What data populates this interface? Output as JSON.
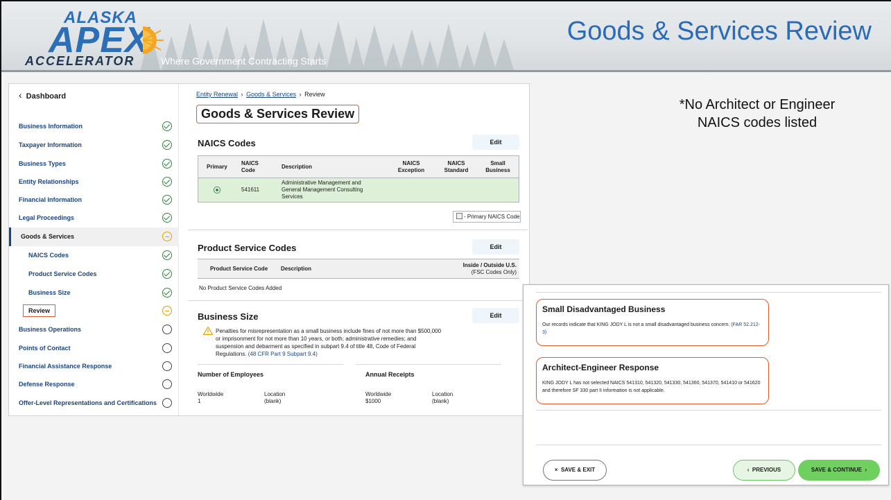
{
  "banner": {
    "logo_top": "ALASKA",
    "logo_main": "APEX",
    "logo_bottom": "ACCELERATOR",
    "tagline": "Where Government Contracting Starts",
    "slide_title": "Goods & Services Review"
  },
  "sidebar": {
    "dashboard": "Dashboard",
    "items": [
      {
        "label": "Business Information",
        "status": "complete"
      },
      {
        "label": "Taxpayer Information",
        "status": "complete"
      },
      {
        "label": "Business Types",
        "status": "complete"
      },
      {
        "label": "Entity Relationships",
        "status": "complete"
      },
      {
        "label": "Financial Information",
        "status": "complete"
      },
      {
        "label": "Legal Proceedings",
        "status": "complete"
      },
      {
        "label": "Goods & Services",
        "status": "in-progress"
      },
      {
        "label": "NAICS Codes",
        "status": "complete"
      },
      {
        "label": "Product Service Codes",
        "status": "complete"
      },
      {
        "label": "Business Size",
        "status": "complete"
      },
      {
        "label": "Review",
        "status": "in-progress"
      },
      {
        "label": "Business Operations",
        "status": "not-started"
      },
      {
        "label": "Points of Contact",
        "status": "not-started"
      },
      {
        "label": "Financial Assistance Response",
        "status": "not-started"
      },
      {
        "label": "Defense Response",
        "status": "not-started"
      },
      {
        "label": "Offer-Level Representations and Certifications",
        "status": "not-started"
      }
    ]
  },
  "content": {
    "breadcrumb": {
      "c1": "Entity Renewal",
      "sep": "›",
      "c2": "Goods & Services",
      "c3": "Review"
    },
    "page_title": "Goods & Services Review",
    "edit_label": "Edit",
    "naics": {
      "title": "NAICS Codes",
      "headers": {
        "primary": "Primary",
        "code": "NAICS Code",
        "desc": "Description",
        "exception": "NAICS Exception",
        "standard": "NAICS Standard",
        "small": "Small Business"
      },
      "row": {
        "code": "541611",
        "desc": "Administrative Management and General Management Consulting Services"
      },
      "legend": "- Primary NAICS Code"
    },
    "psc": {
      "title": "Product Service Codes",
      "headers": {
        "code": "Product Service Code",
        "desc": "Description",
        "inside": "Inside / Outside U.S.",
        "inside_sub": "(FSC Codes Only)"
      },
      "empty": "No Product Service Codes Added"
    },
    "size": {
      "title": "Business Size",
      "warning": "Penalties for misrepresentation as a small business include fines of not more than $500,000 or imprisonment for not more than 10 years, or both; administrative remedies; and suspension and debarment as specified in subpart 9.4 of title 48, Code of Federal Regulations.",
      "warning_link": "(48 CFR Part 9 Subpart 9.4)",
      "employees_title": "Number of Employees",
      "receipts_title": "Annual Receipts",
      "ww_label": "Worldwide",
      "loc_label": "Location",
      "employees_ww": "1",
      "employees_loc": "(blank)",
      "receipts_ww": "$1000",
      "receipts_loc": "(blank)"
    }
  },
  "note": {
    "line1": "*No Architect or Engineer",
    "line2": "NAICS codes listed"
  },
  "overlay": {
    "sdb_title": "Small Disadvantaged Business",
    "sdb_text": "Our records indicate that KING JODY L is not a small disadvantaged business concern.",
    "sdb_link": "(FAR 52.212-3)",
    "ae_title": "Architect-Engineer Response",
    "ae_text": "KING JODY L has not selected NAICS 541310, 541320, 541330, 541360, 541370, 541410 or 541620 and therefore SF 330 part II information is not applicable.",
    "save_exit": "SAVE & EXIT",
    "previous": "PREVIOUS",
    "save_continue": "SAVE & CONTINUE"
  },
  "colors": {
    "accent": "#2a6bb6",
    "highlight": "#e05a2b",
    "success": "#2e8540",
    "pending": "#e5a000"
  }
}
